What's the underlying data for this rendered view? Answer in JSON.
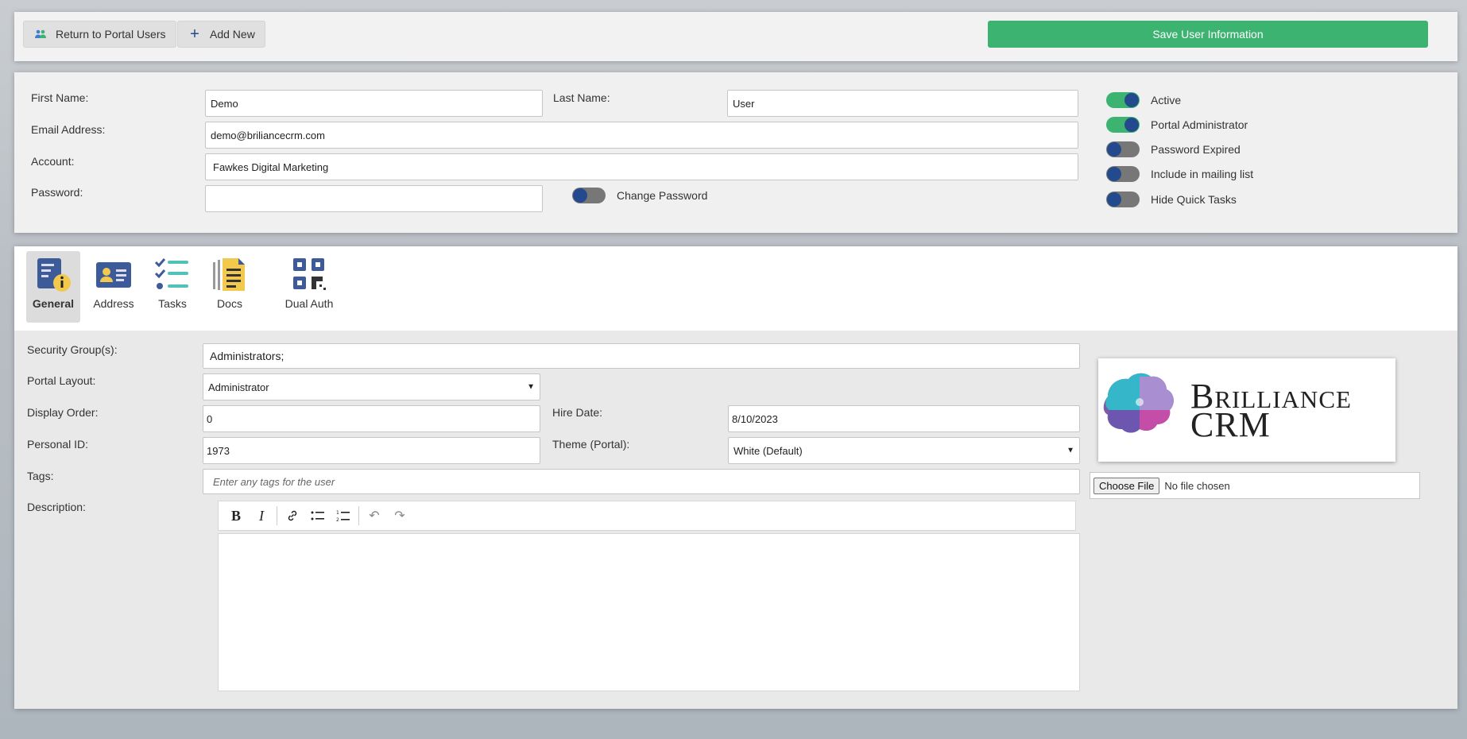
{
  "toolbar": {
    "return_label": "Return to Portal Users",
    "add_label": "Add New",
    "save_label": "Save User Information"
  },
  "user": {
    "first_name_label": "First Name:",
    "first_name": "Demo",
    "last_name_label": "Last Name:",
    "last_name": "User",
    "email_label": "Email Address:",
    "email": "demo@briliancecrm.com",
    "account_label": "Account:",
    "account": "Fawkes Digital Marketing",
    "password_label": "Password:",
    "password": "",
    "change_password_label": "Change Password",
    "change_password_on": false
  },
  "flags": [
    {
      "label": "Active",
      "on": true
    },
    {
      "label": "Portal Administrator",
      "on": true
    },
    {
      "label": "Password Expired",
      "on": false
    },
    {
      "label": "Include in mailing list",
      "on": false
    },
    {
      "label": "Hide Quick Tasks",
      "on": false
    }
  ],
  "tabs": [
    {
      "label": "General",
      "icon": "general-info-icon",
      "active": true
    },
    {
      "label": "Address",
      "icon": "address-card-icon",
      "active": false
    },
    {
      "label": "Tasks",
      "icon": "tasks-checklist-icon",
      "active": false
    },
    {
      "label": "Docs",
      "icon": "docs-icon",
      "active": false
    },
    {
      "label": "Dual Auth",
      "icon": "qr-code-icon",
      "active": false
    }
  ],
  "general": {
    "security_label": "Security Group(s):",
    "security_value": "Administrators;",
    "layout_label": "Portal Layout:",
    "layout_value": "Administrator",
    "display_order_label": "Display Order:",
    "display_order": "0",
    "hire_date_label": "Hire Date:",
    "hire_date": "8/10/2023",
    "personal_id_label": "Personal ID:",
    "personal_id": "1973",
    "theme_label": "Theme (Portal):",
    "theme_value": "White (Default)",
    "tags_label": "Tags:",
    "tags_placeholder": "Enter any tags for the user",
    "description_label": "Description:",
    "description": ""
  },
  "logo": {
    "line1": "Brilliance",
    "line2": "CRM"
  },
  "file": {
    "button_label": "Choose File",
    "status": "No file chosen"
  },
  "colors": {
    "save_green": "#3cb371",
    "toggle_knob": "#234a8d",
    "toggle_on": "#3cb371",
    "toggle_off": "#777777"
  }
}
